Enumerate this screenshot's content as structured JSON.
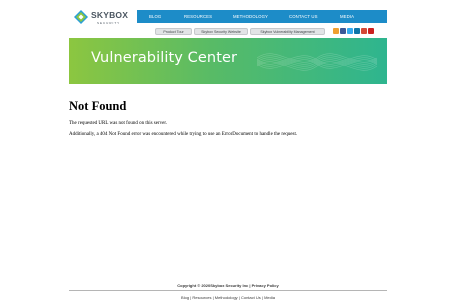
{
  "logo": {
    "name": "SKYBOX",
    "tagline": "SECURITY",
    "icon": "skybox-logo-icon"
  },
  "nav": {
    "items": [
      "BLOG",
      "RESOURCES",
      "METHODOLOGY",
      "CONTACT US",
      "MEDIA"
    ]
  },
  "subtabs": [
    "Product Tour",
    "Skybox Security Website",
    "Skybox Vulnerability Management"
  ],
  "social": {
    "icons": [
      "rss-icon",
      "facebook-icon",
      "twitter-icon",
      "linkedin-icon",
      "google-plus-icon",
      "youtube-icon"
    ],
    "colors": [
      "#f0a030",
      "#3b5998",
      "#33aaf0",
      "#0e76a8",
      "#d34836",
      "#cc2020"
    ]
  },
  "banner": {
    "title": "Vulnerability Center",
    "colors": {
      "start": "#8cc640",
      "end": "#2eb58f"
    }
  },
  "main": {
    "title": "Not Found",
    "line1": "The requested URL was not found on this server.",
    "line2": "Additionally, a 404 Not Found error was encountered while trying to use an ErrorDocument to handle the request."
  },
  "footer": {
    "copyright": "Copyright © 2020Skybox Security Inc | Privacy Policy",
    "links": [
      "Blog",
      "Resources",
      "Methodology",
      "Contact Us",
      "Media"
    ],
    "separator": "|"
  },
  "colors": {
    "nav_bg": "#1d8cc8"
  }
}
